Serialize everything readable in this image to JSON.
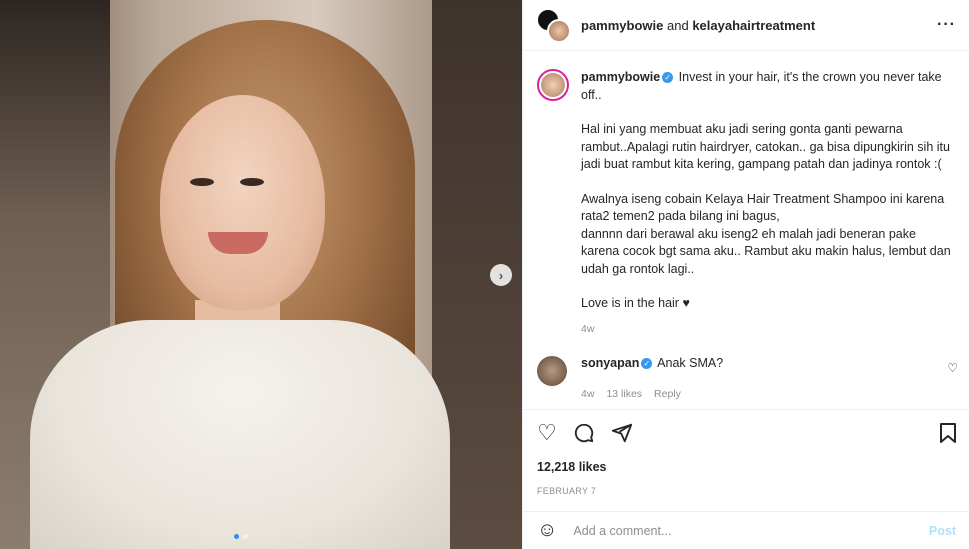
{
  "header": {
    "user1": "pammybowie",
    "and_text": "and",
    "user2": "kelayahairtreatment",
    "more": "···"
  },
  "caption": {
    "username": "pammybowie",
    "first_line": "Invest in your hair, it's the crown you never take off..",
    "para1": "Hal ini yang membuat aku jadi sering gonta ganti pewarna rambut..Apalagi rutin hairdryer, catokan.. ga bisa dipungkirin sih itu jadi buat rambut kita kering, gampang patah dan jadinya rontok :(",
    "para2": "Awalnya iseng cobain Kelaya Hair Treatment Shampoo ini karena rata2 temen2 pada bilang ini bagus,\ndannnn dari berawal aku iseng2 eh malah jadi beneran pake karena cocok bgt sama aku.. Rambut aku makin halus, lembut dan udah ga rontok lagi..",
    "para3": "Love is in the hair ♥",
    "time": "4w"
  },
  "comment": {
    "username": "sonyapan",
    "text": "Anak SMA?",
    "time": "4w",
    "likes": "13 likes",
    "reply": "Reply"
  },
  "post": {
    "likes": "12,218 likes",
    "date": "FEBRUARY 7"
  },
  "add_comment": {
    "placeholder": "Add a comment...",
    "post_label": "Post"
  },
  "carousel": {
    "next": "›"
  }
}
